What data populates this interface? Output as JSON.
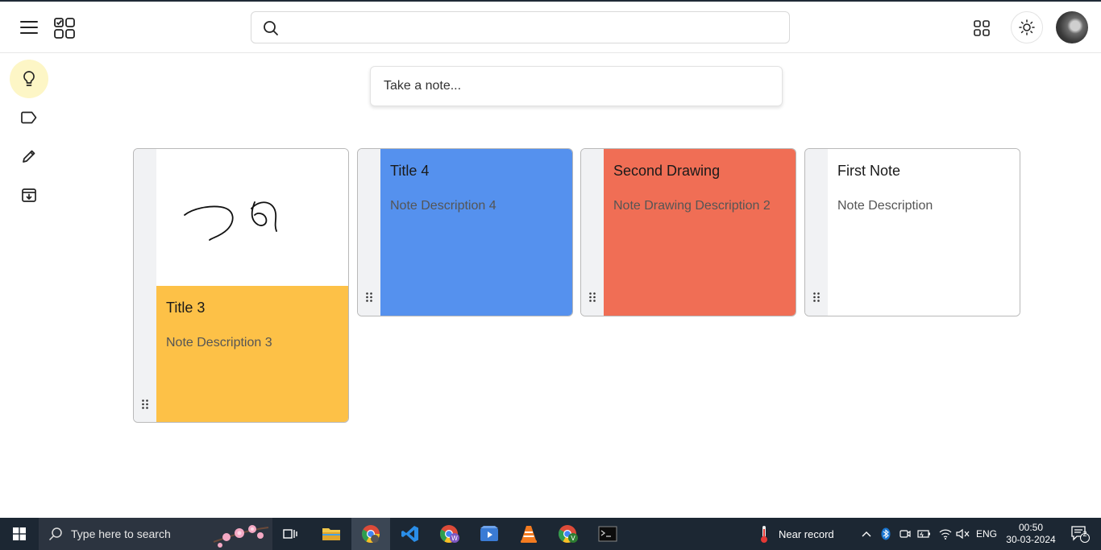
{
  "header": {
    "search_placeholder": ""
  },
  "composer": {
    "placeholder": "Take a note..."
  },
  "notes": [
    {
      "title": "Title 3",
      "description": "Note Description 3",
      "color": "#fdc147",
      "has_drawing": true
    },
    {
      "title": "Title 4",
      "description": "Note Description 4",
      "color": "#5591ee"
    },
    {
      "title": "Second Drawing",
      "description": "Note Drawing Description 2",
      "color": "#f06e55"
    },
    {
      "title": "First Note",
      "description": "Note Description",
      "color": "#ffffff"
    }
  ],
  "sidebar": {
    "items": [
      {
        "icon": "lightbulb-icon",
        "active": true
      },
      {
        "icon": "label-icon"
      },
      {
        "icon": "pencil-icon"
      },
      {
        "icon": "archive-icon"
      }
    ]
  },
  "taskbar": {
    "search_placeholder": "Type here to search",
    "weather": "Near record",
    "language": "ENG",
    "time": "00:50",
    "date": "30-03-2024",
    "notification_count": "2"
  }
}
